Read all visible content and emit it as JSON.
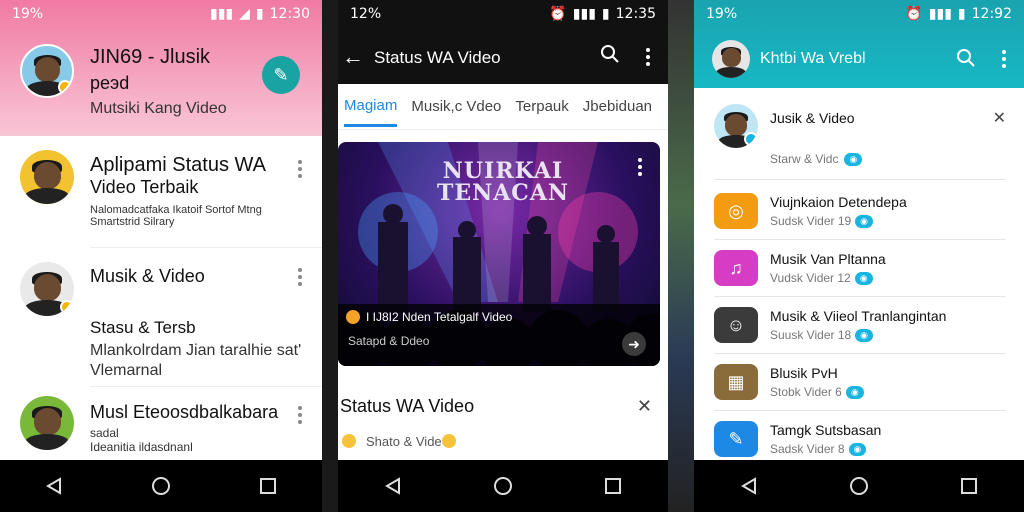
{
  "panel1": {
    "status": {
      "left": "19%",
      "time": "12:30"
    },
    "header": {
      "title": "JIN69 - Jlusik",
      "line2": "реэd",
      "subtitle": "Mutsiki Kang Video"
    },
    "items": [
      {
        "title": "Aplipami Status WA",
        "title2": "Video Terbaik",
        "sub": "Nalomadcatfaka Ikatoif Sortof Mtng",
        "sub2": "Smartstrid Silrary"
      },
      {
        "title": "Musik & Video",
        "detail_title": "Stasu & Tersb",
        "detail_sub": "Mlankolrdam Jian taralhie sat'",
        "detail_sub2": "Vlemarnal"
      },
      {
        "title": "Musl Eteoosdbalkabara",
        "sub": "sadal",
        "sub2": "Ideanitia ildasdnanl"
      }
    ]
  },
  "panel2": {
    "status": {
      "left": "12%",
      "time": "12:35"
    },
    "toolbar": {
      "title": "Status WA Video"
    },
    "tabs": [
      "Magiam",
      "Musik,c Vdeo",
      "Terpauk",
      "Jbebiduan"
    ],
    "card": {
      "poster": "NUIRKAI TENACAN",
      "caption": "I IJ8I2 Nden Tetalgalf Video",
      "sub": "Satapd & Ddeo"
    },
    "section": {
      "title": "Status WA Video",
      "sub": "Shato & Vide"
    }
  },
  "panel3": {
    "status": {
      "left": "19%",
      "time": "12:92"
    },
    "toolbar": {
      "title": "Khtbi Wa Vrebl"
    },
    "top_item": {
      "title": "Jusik & Video",
      "sub": "Starw & Vidc"
    },
    "items": [
      {
        "title": "Viujnkaion Detendepa",
        "sub": "Sudsk Vider 19",
        "icon": "cd-icon",
        "color": "#f39c12"
      },
      {
        "title": "Musik Van Pltanna",
        "sub": "Vudsk Vider 12",
        "icon": "music-app-icon",
        "color": "#d63dc4"
      },
      {
        "title": "Musik & Viieol Tranlangintan",
        "sub": "Suusk Vider 18",
        "icon": "avatar-app-icon",
        "color": "#3b3b3b"
      },
      {
        "title": "Blusik PvH",
        "sub": "Stobk Vider 6",
        "icon": "photos-app-icon",
        "color": "#8a6b3a"
      },
      {
        "title": "Tamgk Sutsbasan",
        "sub": "Sadsk Vider 8",
        "icon": "edit-app-icon",
        "color": "#1e88e5"
      }
    ]
  }
}
